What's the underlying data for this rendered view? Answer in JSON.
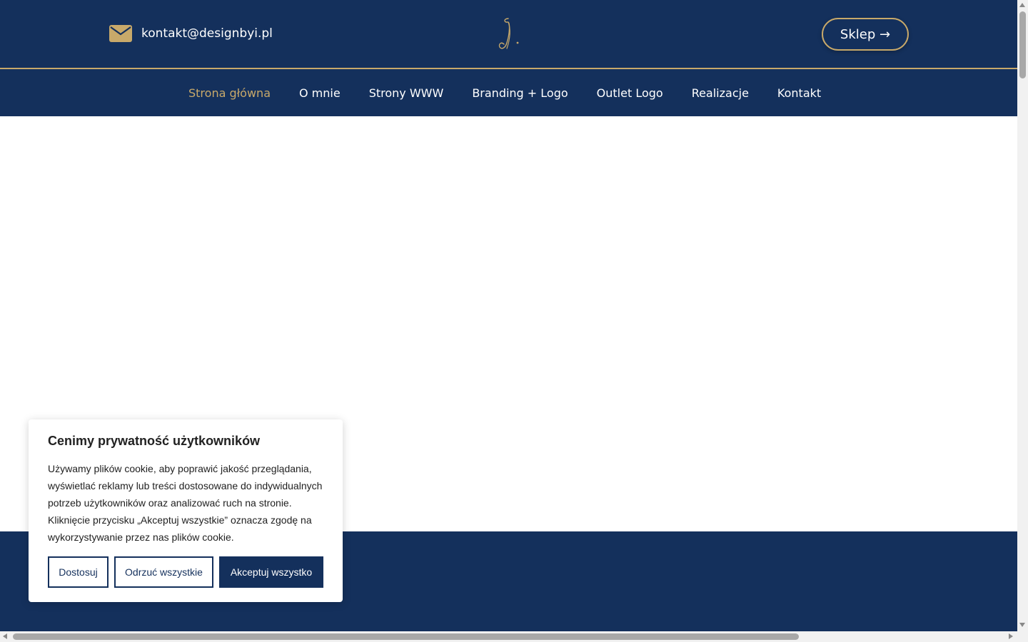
{
  "colors": {
    "navy": "#14305c",
    "gold": "#c8a96a",
    "white": "#ffffff",
    "text_dark": "#212121"
  },
  "header": {
    "email_icon": "envelope-icon",
    "email": "kontakt@designbyi.pl",
    "logo_icon": "script-i-logo-icon",
    "shop_button": "Sklep →"
  },
  "nav": {
    "items": [
      {
        "label": "Strona główna",
        "active": true
      },
      {
        "label": "O mnie"
      },
      {
        "label": "Strony WWW"
      },
      {
        "label": "Branding + Logo"
      },
      {
        "label": "Outlet Logo"
      },
      {
        "label": "Realizacje"
      },
      {
        "label": "Kontakt"
      }
    ]
  },
  "cookie": {
    "title": "Cenimy prywatność użytkowników",
    "text": "Używamy plików cookie, aby poprawić jakość przeglądania, wyświetlać reklamy lub treści dostosowane do indywidualnych potrzeb użytkowników oraz analizować ruch na stronie. Kliknięcie przycisku „Akceptuj wszystkie” oznacza zgodę na wykorzystywanie przez nas plików cookie.",
    "customize": "Dostosuj",
    "reject": "Odrzuć wszystkie",
    "accept": "Akceptuj wszystko"
  }
}
